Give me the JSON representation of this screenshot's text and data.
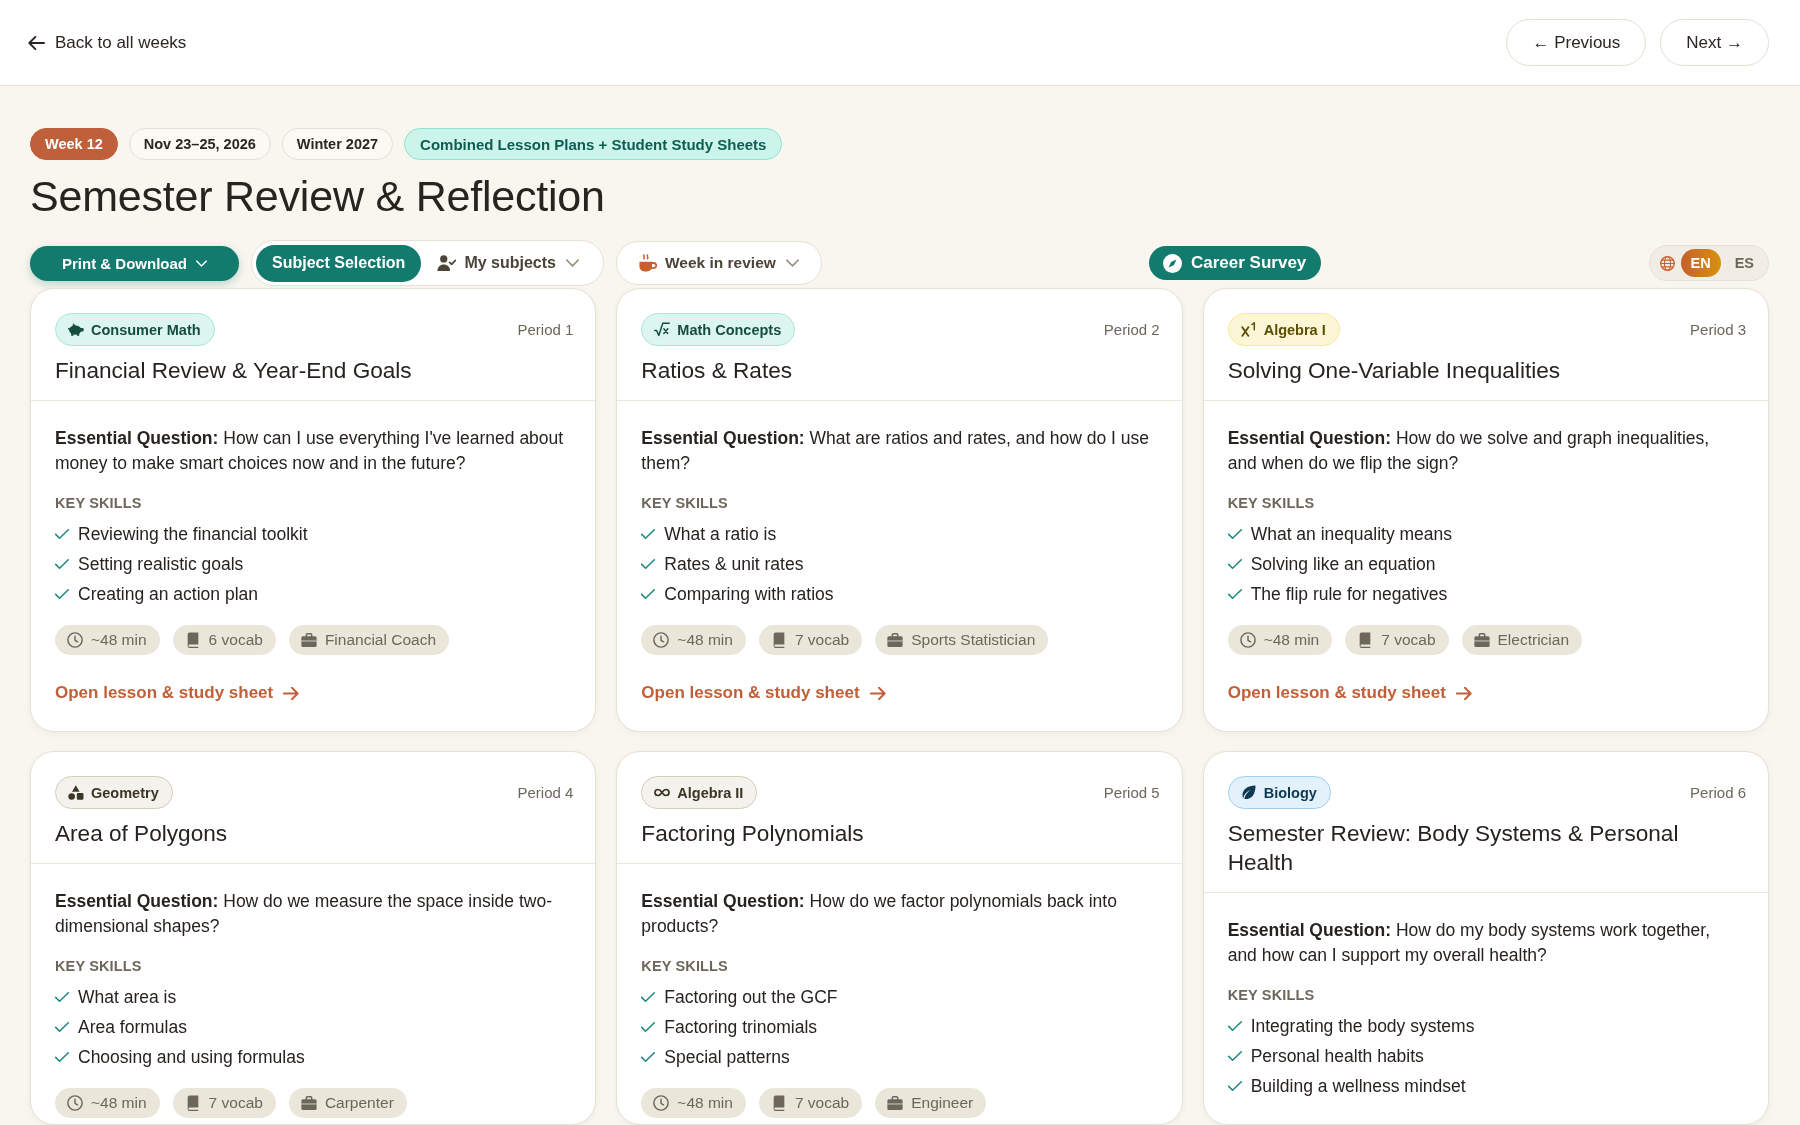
{
  "header": {
    "back_link": "Back to all weeks",
    "nav_buttons": [
      "← Previous",
      "Next →"
    ]
  },
  "week": {
    "badges": [
      {
        "kind": "week",
        "label": "Week 12"
      },
      {
        "kind": "plain",
        "label": "Nov 23–25, 2026"
      },
      {
        "kind": "plain",
        "label": "Winter 2027"
      },
      {
        "kind": "highlight",
        "label": "Combined Lesson Plans + Student Study Sheets"
      }
    ],
    "title": "Semester Review & Reflection"
  },
  "toolbar": {
    "print_button": "Print & Download",
    "subject_toggle": [
      {
        "kind": "plain",
        "label": "Subject Selection",
        "selected": true
      },
      {
        "kind": "menu",
        "label": "My subjects",
        "selected": false
      }
    ],
    "week_review_button": "Week in review",
    "career_button": "Career Survey",
    "language": [
      {
        "label": "EN",
        "selected": true
      },
      {
        "label": "ES",
        "selected": false
      }
    ]
  },
  "lessons": [
    {
      "subject": {
        "kind": "money",
        "label": "Consumer Math",
        "color": "#dcf6ef"
      },
      "period": "Period 1",
      "title": "Financial Review & Year-End Goals",
      "essential_question": "**Essential Question:** How can I use everything I've learned about money to make smart choices now and in the future?",
      "skills_heading": "KEY SKILLS",
      "skills": [
        "Reviewing the financial toolkit",
        "Setting realistic goals",
        "Creating an action plan"
      ],
      "meta": [
        {
          "kind": "duration",
          "label": "~48 min"
        },
        {
          "kind": "vocab",
          "label": "6 vocab"
        },
        {
          "kind": "career",
          "label": "Financial Coach"
        }
      ],
      "link": "Open lesson & study sheet"
    },
    {
      "subject": {
        "kind": "radical",
        "label": "Math Concepts",
        "color": "#dcf6ef"
      },
      "period": "Period 2",
      "title": "Ratios & Rates",
      "essential_question": "**Essential Question:** What are ratios and rates, and how do I use them?",
      "skills_heading": "KEY SKILLS",
      "skills": [
        "What a ratio is",
        "Rates & unit rates",
        "Comparing with ratios"
      ],
      "meta": [
        {
          "kind": "duration",
          "label": "~48 min"
        },
        {
          "kind": "vocab",
          "label": "7 vocab"
        },
        {
          "kind": "career",
          "label": "Sports Statistician"
        }
      ],
      "link": "Open lesson & study sheet"
    },
    {
      "subject": {
        "kind": "exponent",
        "label": "Algebra I",
        "color": "#fdf6d6"
      },
      "period": "Period 3",
      "title": "Solving One-Variable Inequalities",
      "essential_question": "**Essential Question:** How do we solve and graph inequalities, and when do we flip the sign?",
      "skills_heading": "KEY SKILLS",
      "skills": [
        "What an inequality means",
        "Solving like an equation",
        "The flip rule for negatives"
      ],
      "meta": [
        {
          "kind": "duration",
          "label": "~48 min"
        },
        {
          "kind": "vocab",
          "label": "7 vocab"
        },
        {
          "kind": "career",
          "label": "Electrician"
        }
      ],
      "link": "Open lesson & study sheet"
    },
    {
      "subject": {
        "kind": "geometry",
        "label": "Geometry",
        "color": "#f4f2ed"
      },
      "period": "Period 4",
      "title": "Area of Polygons",
      "essential_question": "**Essential Question:** How do we measure the space inside two-dimensional shapes?",
      "skills_heading": "KEY SKILLS",
      "skills": [
        "What area is",
        "Area formulas",
        "Choosing and using formulas"
      ],
      "meta": [
        {
          "kind": "duration",
          "label": "~48 min"
        },
        {
          "kind": "vocab",
          "label": "7 vocab"
        },
        {
          "kind": "career",
          "label": "Carpenter"
        }
      ]
    },
    {
      "subject": {
        "kind": "infinity",
        "label": "Algebra II",
        "color": "#f4f2ed"
      },
      "period": "Period 5",
      "title": "Factoring Polynomials",
      "essential_question": "**Essential Question:** How do we factor polynomials back into products?",
      "skills_heading": "KEY SKILLS",
      "skills": [
        "Factoring out the GCF",
        "Factoring trinomials",
        "Special patterns"
      ],
      "meta": [
        {
          "kind": "duration",
          "label": "~48 min"
        },
        {
          "kind": "vocab",
          "label": "7 vocab"
        },
        {
          "kind": "career",
          "label": "Engineer"
        }
      ]
    },
    {
      "subject": {
        "kind": "nature",
        "label": "Biology",
        "color": "#e3f1fa"
      },
      "period": "Period 6",
      "title": "Semester Review: Body Systems & Personal Health",
      "essential_question": "**Essential Question:** How do my body systems work together, and how can I support my overall health?",
      "skills_heading": "KEY SKILLS",
      "skills": [
        "Integrating the body systems",
        "Personal health habits",
        "Building a wellness mindset"
      ]
    }
  ]
}
